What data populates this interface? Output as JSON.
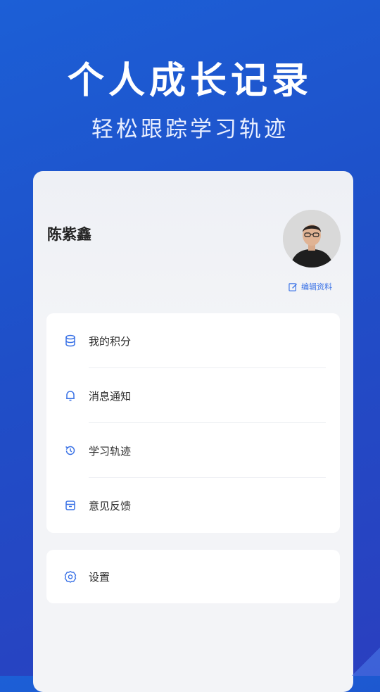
{
  "hero": {
    "title": "个人成长记录",
    "subtitle": "轻松跟踪学习轨迹"
  },
  "profile": {
    "name": "陈紫鑫",
    "edit_label": "编辑资料",
    "edit_icon": "edit-icon",
    "avatar": "avatar-photo"
  },
  "menu": {
    "items": [
      {
        "label": "我的积分",
        "icon": "database-icon"
      },
      {
        "label": "消息通知",
        "icon": "bell-icon"
      },
      {
        "label": "学习轨迹",
        "icon": "history-icon"
      },
      {
        "label": "意见反馈",
        "icon": "box-icon"
      }
    ],
    "settings": {
      "label": "设置",
      "icon": "gear-icon"
    }
  },
  "colors": {
    "background_gradient": [
      "#1c5fd6",
      "#2a3fbf"
    ],
    "accent": "#3a72e6",
    "icon_color": "#3a72e6",
    "card_bg": "#f3f4f7"
  }
}
